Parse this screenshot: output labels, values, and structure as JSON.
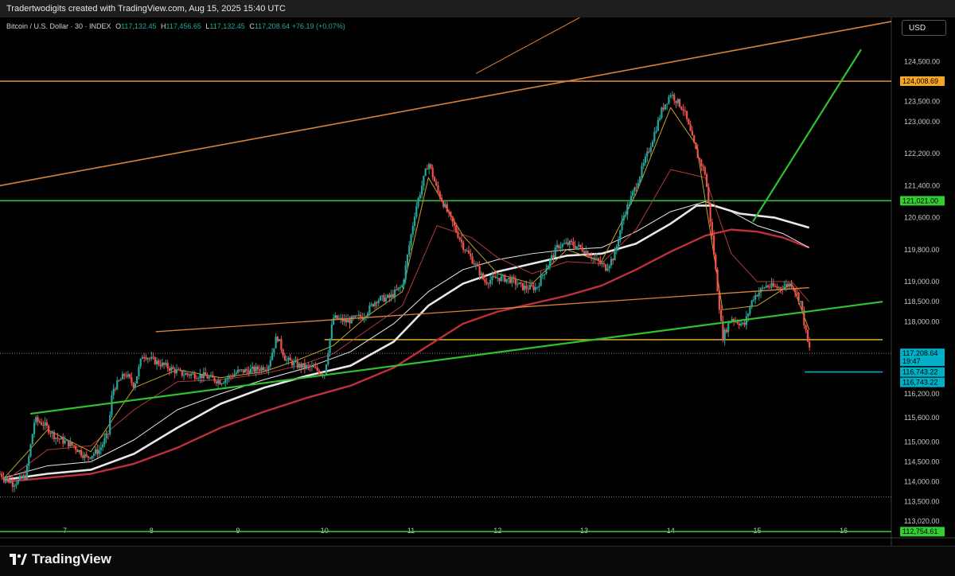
{
  "banner": {
    "text": "Tradertwodigits created with TradingView.com, Aug 15, 2025 15:40 UTC"
  },
  "legend": {
    "symbol": "Bitcoin / U.S. Dollar · 30 · INDEX",
    "o_label": "O",
    "o_value": "117,132.45",
    "h_label": "H",
    "h_value": "117,456.65",
    "l_label": "L",
    "l_value": "117,132.45",
    "c_label": "C",
    "c_value": "117,208.64",
    "change": "+76.19 (+0.07%)"
  },
  "currency_button": "USD",
  "branding": {
    "name": "TradingView"
  },
  "colors": {
    "up": "#26a69a",
    "down": "#ef5350",
    "green_line": "#2fc22f",
    "orange_line": "#d9823b",
    "ema_fast": "#c9a227",
    "ema_red_thin": "#b03a3a",
    "sma_white": "#e8e8e8",
    "sma_red": "#c0303a",
    "current_price_bg": "#00b0c7",
    "orange_label_bg": "#f5a623",
    "green_label_bg": "#33cc33"
  },
  "chart_data": {
    "type": "candlestick",
    "symbol": "Bitcoin / U.S. Dollar",
    "interval": "30",
    "y_axis": {
      "range": [
        112600,
        125600
      ],
      "ticks": [
        "124,500.00",
        "123,500.00",
        "123,000.00",
        "122,200.00",
        "121,400.00",
        "120,600.00",
        "119,800.00",
        "119,000.00",
        "118,500.00",
        "118,000.00",
        "116,200.00",
        "115,600.00",
        "115,000.00",
        "114,500.00",
        "114,000.00",
        "113,500.00",
        "113,020.00"
      ],
      "tick_values": [
        124500,
        123500,
        123000,
        122200,
        121400,
        120600,
        119800,
        119000,
        118500,
        118000,
        116200,
        115600,
        115000,
        114500,
        114000,
        113500,
        113020
      ]
    },
    "x_axis": {
      "range": [
        6.25,
        16.55
      ],
      "ticks": [
        "7",
        "8",
        "9",
        "10",
        "11",
        "12",
        "13",
        "14",
        "15",
        "16"
      ],
      "tick_values": [
        7,
        8,
        9,
        10,
        11,
        12,
        13,
        14,
        15,
        16
      ]
    },
    "price_path": [
      [
        6.25,
        114200
      ],
      [
        6.4,
        113950
      ],
      [
        6.55,
        114150
      ],
      [
        6.65,
        115550
      ],
      [
        6.75,
        115450
      ],
      [
        6.9,
        115100
      ],
      [
        7.1,
        114900
      ],
      [
        7.25,
        114600
      ],
      [
        7.4,
        114800
      ],
      [
        7.5,
        115200
      ],
      [
        7.55,
        116300
      ],
      [
        7.7,
        116700
      ],
      [
        7.8,
        116400
      ],
      [
        7.9,
        117200
      ],
      [
        8.0,
        117050
      ],
      [
        8.15,
        116900
      ],
      [
        8.35,
        116700
      ],
      [
        8.6,
        116650
      ],
      [
        8.8,
        116500
      ],
      [
        9.0,
        116750
      ],
      [
        9.2,
        116800
      ],
      [
        9.35,
        116900
      ],
      [
        9.45,
        117650
      ],
      [
        9.55,
        117050
      ],
      [
        9.7,
        116900
      ],
      [
        9.85,
        116850
      ],
      [
        10.0,
        116700
      ],
      [
        10.1,
        118100
      ],
      [
        10.25,
        118000
      ],
      [
        10.45,
        118150
      ],
      [
        10.6,
        118550
      ],
      [
        10.75,
        118600
      ],
      [
        10.9,
        118900
      ],
      [
        11.05,
        120800
      ],
      [
        11.2,
        122000
      ],
      [
        11.3,
        121300
      ],
      [
        11.45,
        120600
      ],
      [
        11.6,
        119900
      ],
      [
        11.75,
        119400
      ],
      [
        11.85,
        119000
      ],
      [
        12.0,
        119100
      ],
      [
        12.15,
        119050
      ],
      [
        12.3,
        118850
      ],
      [
        12.45,
        118850
      ],
      [
        12.55,
        119300
      ],
      [
        12.7,
        119900
      ],
      [
        12.85,
        119950
      ],
      [
        13.0,
        119800
      ],
      [
        13.1,
        119600
      ],
      [
        13.25,
        119350
      ],
      [
        13.35,
        119650
      ],
      [
        13.45,
        120600
      ],
      [
        13.6,
        121400
      ],
      [
        13.75,
        122300
      ],
      [
        13.9,
        123300
      ],
      [
        14.0,
        123700
      ],
      [
        14.15,
        123300
      ],
      [
        14.3,
        122200
      ],
      [
        14.4,
        121700
      ],
      [
        14.5,
        119700
      ],
      [
        14.6,
        117600
      ],
      [
        14.7,
        118100
      ],
      [
        14.85,
        117900
      ],
      [
        14.95,
        118600
      ],
      [
        15.1,
        118900
      ],
      [
        15.25,
        118850
      ],
      [
        15.4,
        118950
      ],
      [
        15.5,
        118500
      ],
      [
        15.58,
        117500
      ],
      [
        15.62,
        117208.64
      ]
    ],
    "indicators": {
      "ema_fast": [
        [
          6.3,
          114100
        ],
        [
          6.8,
          115300
        ],
        [
          7.3,
          114750
        ],
        [
          7.8,
          116350
        ],
        [
          8.3,
          116800
        ],
        [
          8.8,
          116600
        ],
        [
          9.3,
          116750
        ],
        [
          9.7,
          117050
        ],
        [
          10.1,
          117400
        ],
        [
          10.5,
          118150
        ],
        [
          10.9,
          118750
        ],
        [
          11.2,
          121600
        ],
        [
          11.6,
          120150
        ],
        [
          12.0,
          119200
        ],
        [
          12.4,
          118950
        ],
        [
          12.8,
          119800
        ],
        [
          13.2,
          119500
        ],
        [
          13.6,
          121200
        ],
        [
          14.0,
          123350
        ],
        [
          14.3,
          122400
        ],
        [
          14.6,
          118300
        ],
        [
          15.0,
          118400
        ],
        [
          15.4,
          118950
        ],
        [
          15.6,
          117800
        ]
      ],
      "ema_red_thin": [
        [
          6.3,
          114000
        ],
        [
          6.8,
          114800
        ],
        [
          7.3,
          114900
        ],
        [
          7.8,
          115800
        ],
        [
          8.3,
          116500
        ],
        [
          8.8,
          116550
        ],
        [
          9.3,
          116700
        ],
        [
          9.7,
          116900
        ],
        [
          10.1,
          117200
        ],
        [
          10.5,
          117800
        ],
        [
          10.9,
          118400
        ],
        [
          11.3,
          120400
        ],
        [
          11.7,
          120100
        ],
        [
          12.0,
          119600
        ],
        [
          12.4,
          119200
        ],
        [
          12.8,
          119500
        ],
        [
          13.2,
          119450
        ],
        [
          13.6,
          120300
        ],
        [
          14.0,
          121800
        ],
        [
          14.4,
          121600
        ],
        [
          14.7,
          119700
        ],
        [
          15.0,
          119000
        ],
        [
          15.4,
          119000
        ],
        [
          15.6,
          118500
        ]
      ],
      "sma_white": [
        [
          6.3,
          114100
        ],
        [
          6.8,
          114400
        ],
        [
          7.3,
          114500
        ],
        [
          7.8,
          115050
        ],
        [
          8.3,
          115800
        ],
        [
          8.8,
          116200
        ],
        [
          9.3,
          116550
        ],
        [
          9.8,
          116850
        ],
        [
          10.3,
          117250
        ],
        [
          10.8,
          117950
        ],
        [
          11.2,
          118750
        ],
        [
          11.6,
          119300
        ],
        [
          12.0,
          119550
        ],
        [
          12.4,
          119700
        ],
        [
          12.8,
          119800
        ],
        [
          13.2,
          119850
        ],
        [
          13.6,
          120250
        ],
        [
          14.0,
          120750
        ],
        [
          14.4,
          121000
        ],
        [
          14.7,
          120750
        ],
        [
          15.0,
          120400
        ],
        [
          15.3,
          120200
        ],
        [
          15.6,
          119850
        ]
      ],
      "sma_white_thick": [
        [
          6.3,
          114050
        ],
        [
          6.8,
          114200
        ],
        [
          7.3,
          114300
        ],
        [
          7.8,
          114700
        ],
        [
          8.3,
          115350
        ],
        [
          8.8,
          115950
        ],
        [
          9.3,
          116350
        ],
        [
          9.8,
          116650
        ],
        [
          10.3,
          116900
        ],
        [
          10.8,
          117500
        ],
        [
          11.2,
          118400
        ],
        [
          11.6,
          118950
        ],
        [
          12.0,
          119250
        ],
        [
          12.4,
          119450
        ],
        [
          12.8,
          119650
        ],
        [
          13.2,
          119700
        ],
        [
          13.6,
          119950
        ],
        [
          14.0,
          120450
        ],
        [
          14.3,
          120900
        ],
        [
          14.5,
          120900
        ],
        [
          14.8,
          120700
        ],
        [
          15.2,
          120600
        ],
        [
          15.6,
          120350
        ]
      ],
      "sma_red": [
        [
          6.3,
          114000
        ],
        [
          6.8,
          114100
        ],
        [
          7.3,
          114200
        ],
        [
          7.8,
          114450
        ],
        [
          8.3,
          114850
        ],
        [
          8.8,
          115350
        ],
        [
          9.3,
          115750
        ],
        [
          9.8,
          116100
        ],
        [
          10.3,
          116400
        ],
        [
          10.8,
          116850
        ],
        [
          11.2,
          117400
        ],
        [
          11.6,
          117950
        ],
        [
          12.0,
          118250
        ],
        [
          12.4,
          118450
        ],
        [
          12.8,
          118650
        ],
        [
          13.2,
          118900
        ],
        [
          13.6,
          119300
        ],
        [
          14.0,
          119750
        ],
        [
          14.4,
          120150
        ],
        [
          14.7,
          120300
        ],
        [
          15.0,
          120250
        ],
        [
          15.3,
          120100
        ],
        [
          15.6,
          119850
        ]
      ]
    },
    "horizontal_levels": [
      {
        "price": 124008.69,
        "label": "124,008.69",
        "color": "#d9823b",
        "style": "solid"
      },
      {
        "price": 121021.0,
        "label": "121,021.00",
        "color": "#2fc22f",
        "style": "solid"
      },
      {
        "price": 112754.61,
        "label": "112,754.61",
        "color": "#2fc22f",
        "style": "solid"
      },
      {
        "price": 117550,
        "label": "",
        "color": "#c9a227",
        "style": "solid",
        "from_x": 10.0,
        "to_x": 16.45
      },
      {
        "price": 116743.22,
        "label": "116,743.22",
        "color": "#00b0c7",
        "style": "solid",
        "from_x": 15.55,
        "to_x": 16.45
      },
      {
        "price": 113620,
        "label": "",
        "color": "#888888",
        "style": "dotted"
      },
      {
        "price": 117208.64,
        "label": "117,208.64",
        "color": "#888888",
        "style": "dotted"
      }
    ],
    "trendlines": [
      {
        "from": [
          6.25,
          121400
        ],
        "to": [
          16.55,
          125500
        ],
        "color": "#d9823b",
        "width": 1.6
      },
      {
        "from": [
          8.05,
          117750
        ],
        "to": [
          15.6,
          118850
        ],
        "color": "#d9823b",
        "width": 1.3
      },
      {
        "from": [
          6.6,
          115700
        ],
        "to": [
          16.45,
          118500
        ],
        "color": "#2fc22f",
        "width": 2.2
      },
      {
        "from": [
          14.95,
          120500
        ],
        "to": [
          16.2,
          124800
        ],
        "color": "#2fc22f",
        "width": 2.2
      },
      {
        "from": [
          11.75,
          124200
        ],
        "to": [
          12.95,
          125600
        ],
        "color": "#d9823b",
        "width": 1
      }
    ],
    "price_labels": [
      {
        "price": 124008.69,
        "text": "124,008.69",
        "bg": "#f5a623",
        "fg": "#000000"
      },
      {
        "price": 121021.0,
        "text": "121,021.00",
        "bg": "#33cc33",
        "fg": "#000000"
      },
      {
        "price": 117208.64,
        "text": "117,208.64",
        "bg": "#00b0c7",
        "fg": "#000000",
        "sub": "19:47"
      },
      {
        "price": 116743.22,
        "text": "116,743.22",
        "bg": "#00b0c7",
        "fg": "#000000"
      },
      {
        "price": 116743.22,
        "text": "116,743.22",
        "bg": "#00b0c7",
        "fg": "#000000",
        "offset": 1
      },
      {
        "price": 112754.61,
        "text": "112,754.61",
        "bg": "#33cc33",
        "fg": "#000000"
      }
    ]
  }
}
